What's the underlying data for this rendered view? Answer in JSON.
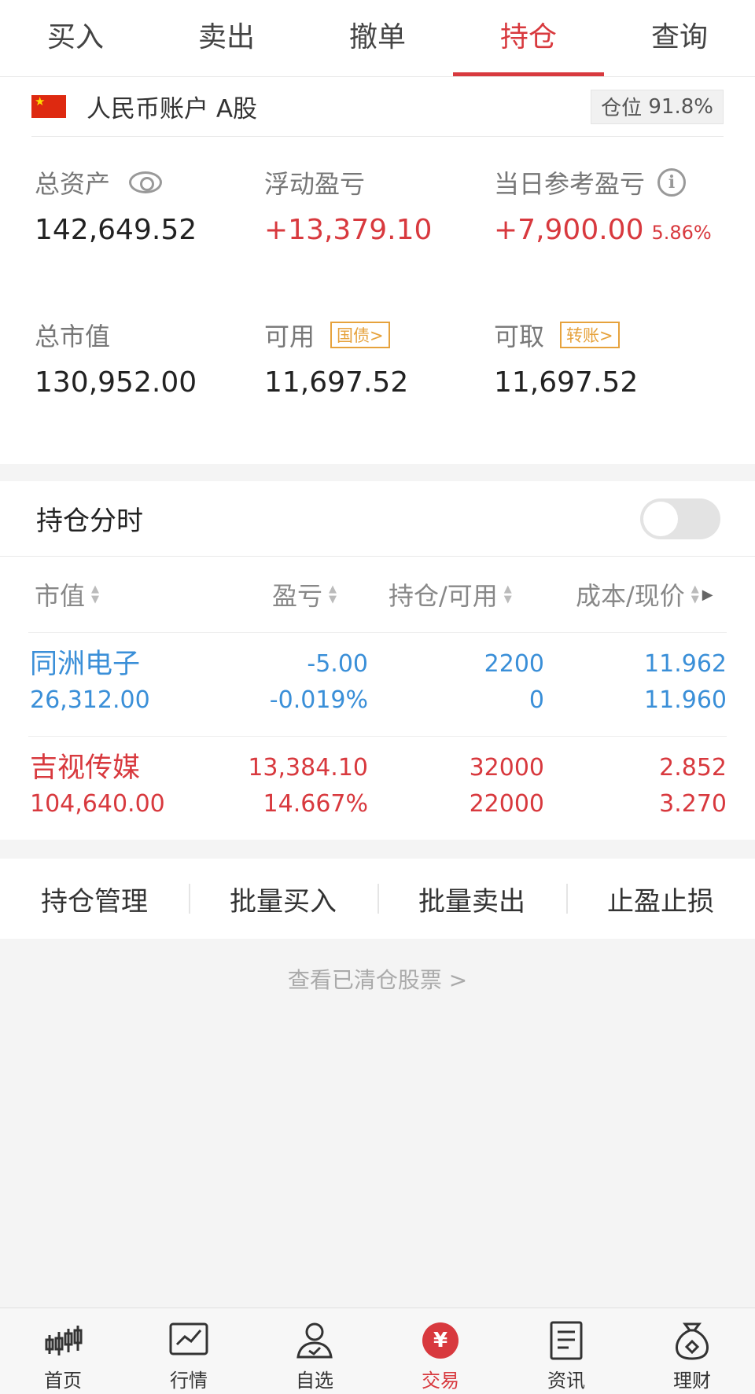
{
  "tabs": [
    {
      "label": "买入"
    },
    {
      "label": "卖出"
    },
    {
      "label": "撤单"
    },
    {
      "label": "持仓",
      "active": true
    },
    {
      "label": "查询"
    }
  ],
  "account": {
    "name": "人民币账户 A股",
    "position_label": "仓位",
    "position_value": "91.8%"
  },
  "stats": {
    "total_assets": {
      "label": "总资产",
      "value": "142,649.52"
    },
    "floating_pl": {
      "label": "浮动盈亏",
      "value": "+13,379.10"
    },
    "daily_pl": {
      "label": "当日参考盈亏",
      "value": "+7,900.00",
      "pct": "5.86%"
    },
    "market_value": {
      "label": "总市值",
      "value": "130,952.00"
    },
    "available": {
      "label": "可用",
      "tag": "国债>",
      "value": "11,697.52"
    },
    "withdrawable": {
      "label": "可取",
      "tag": "转账>",
      "value": "11,697.52"
    }
  },
  "holdings": {
    "title": "持仓分时",
    "columns": [
      "市值",
      "盈亏",
      "持仓/可用",
      "成本/现价"
    ],
    "rows": [
      {
        "name": "同洲电子",
        "market_value": "26,312.00",
        "pl": "-5.00",
        "pl_pct": "-0.019%",
        "hold": "2200",
        "avail": "0",
        "cost": "11.962",
        "price": "11.960",
        "color": "#3a8fd8"
      },
      {
        "name": "吉视传媒",
        "market_value": "104,640.00",
        "pl": "13,384.10",
        "pl_pct": "14.667%",
        "hold": "32000",
        "avail": "22000",
        "cost": "2.852",
        "price": "3.270",
        "color": "#d8393e"
      }
    ]
  },
  "actions": [
    "持仓管理",
    "批量买入",
    "批量卖出",
    "止盈止损"
  ],
  "cleared_link": "查看已清仓股票 >",
  "bottom_nav": [
    {
      "label": "首页",
      "icon": "candlestick-icon"
    },
    {
      "label": "行情",
      "icon": "chart-icon"
    },
    {
      "label": "自选",
      "icon": "user-check-icon"
    },
    {
      "label": "交易",
      "icon": "yen-icon",
      "active": true
    },
    {
      "label": "资讯",
      "icon": "document-icon"
    },
    {
      "label": "理财",
      "icon": "money-bag-icon"
    }
  ],
  "colors": {
    "accent": "#d8393e",
    "fall": "#3a8fd8",
    "tag": "#e6a23c"
  }
}
